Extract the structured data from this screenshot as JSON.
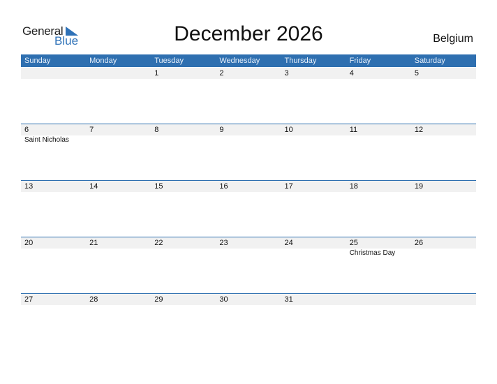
{
  "logo": {
    "general": "General",
    "blue": "Blue"
  },
  "title": "December 2026",
  "country": "Belgium",
  "colors": {
    "accent": "#2e6fb0",
    "band": "#f1f1f1"
  },
  "weekdays": [
    "Sunday",
    "Monday",
    "Tuesday",
    "Wednesday",
    "Thursday",
    "Friday",
    "Saturday"
  ],
  "weeks": [
    [
      {
        "day": ""
      },
      {
        "day": ""
      },
      {
        "day": "1"
      },
      {
        "day": "2"
      },
      {
        "day": "3"
      },
      {
        "day": "4"
      },
      {
        "day": "5"
      }
    ],
    [
      {
        "day": "6",
        "event": "Saint Nicholas"
      },
      {
        "day": "7"
      },
      {
        "day": "8"
      },
      {
        "day": "9"
      },
      {
        "day": "10"
      },
      {
        "day": "11"
      },
      {
        "day": "12"
      }
    ],
    [
      {
        "day": "13"
      },
      {
        "day": "14"
      },
      {
        "day": "15"
      },
      {
        "day": "16"
      },
      {
        "day": "17"
      },
      {
        "day": "18"
      },
      {
        "day": "19"
      }
    ],
    [
      {
        "day": "20"
      },
      {
        "day": "21"
      },
      {
        "day": "22"
      },
      {
        "day": "23"
      },
      {
        "day": "24"
      },
      {
        "day": "25",
        "event": "Christmas Day"
      },
      {
        "day": "26"
      }
    ],
    [
      {
        "day": "27"
      },
      {
        "day": "28"
      },
      {
        "day": "29"
      },
      {
        "day": "30"
      },
      {
        "day": "31"
      },
      {
        "day": ""
      },
      {
        "day": ""
      }
    ]
  ]
}
